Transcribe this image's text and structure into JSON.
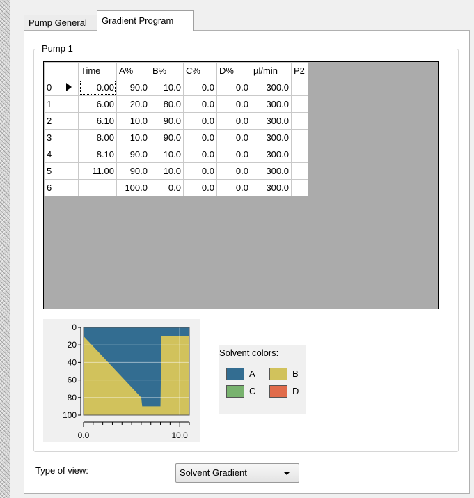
{
  "tabs": [
    "Pump General",
    "Gradient Program"
  ],
  "active_tab": "Gradient Program",
  "group_title": "Pump 1",
  "grid": {
    "columns": [
      "",
      "Time",
      "A%",
      "B%",
      "C%",
      "D%",
      "µl/min",
      "P2"
    ],
    "rows": [
      {
        "index": "0",
        "time": "0.00",
        "a": "90.0",
        "b": "10.0",
        "c": "0.0",
        "d": "0.0",
        "flow": "300.0",
        "p2": ""
      },
      {
        "index": "1",
        "time": "6.00",
        "a": "20.0",
        "b": "80.0",
        "c": "0.0",
        "d": "0.0",
        "flow": "300.0",
        "p2": ""
      },
      {
        "index": "2",
        "time": "6.10",
        "a": "10.0",
        "b": "90.0",
        "c": "0.0",
        "d": "0.0",
        "flow": "300.0",
        "p2": ""
      },
      {
        "index": "3",
        "time": "8.00",
        "a": "10.0",
        "b": "90.0",
        "c": "0.0",
        "d": "0.0",
        "flow": "300.0",
        "p2": ""
      },
      {
        "index": "4",
        "time": "8.10",
        "a": "90.0",
        "b": "10.0",
        "c": "0.0",
        "d": "0.0",
        "flow": "300.0",
        "p2": ""
      },
      {
        "index": "5",
        "time": "11.00",
        "a": "90.0",
        "b": "10.0",
        "c": "0.0",
        "d": "0.0",
        "flow": "300.0",
        "p2": ""
      },
      {
        "index": "6",
        "time": "",
        "a": "100.0",
        "b": "0.0",
        "c": "0.0",
        "d": "0.0",
        "flow": "300.0",
        "p2": ""
      }
    ]
  },
  "chart_data": {
    "type": "area",
    "x_ticks": [
      "0.0",
      "10.0"
    ],
    "y_ticks": [
      "0",
      "20",
      "40",
      "60",
      "80",
      "100"
    ],
    "xlim": [
      0,
      11
    ],
    "ylim": [
      0,
      100
    ],
    "y_inverted": true,
    "series": [
      {
        "name": "B",
        "x": [
          0.0,
          6.0,
          6.1,
          8.0,
          8.1,
          11.0
        ],
        "values": [
          10.0,
          80.0,
          90.0,
          90.0,
          10.0,
          10.0
        ]
      }
    ]
  },
  "legend": {
    "title": "Solvent colors:",
    "items": [
      {
        "label": "A",
        "color": "#336d91"
      },
      {
        "label": "B",
        "color": "#d1c25c"
      },
      {
        "label": "C",
        "color": "#78b26e"
      },
      {
        "label": "D",
        "color": "#e06b4a"
      }
    ]
  },
  "type_of_view": {
    "label": "Type of view:",
    "value": "Solvent Gradient"
  }
}
